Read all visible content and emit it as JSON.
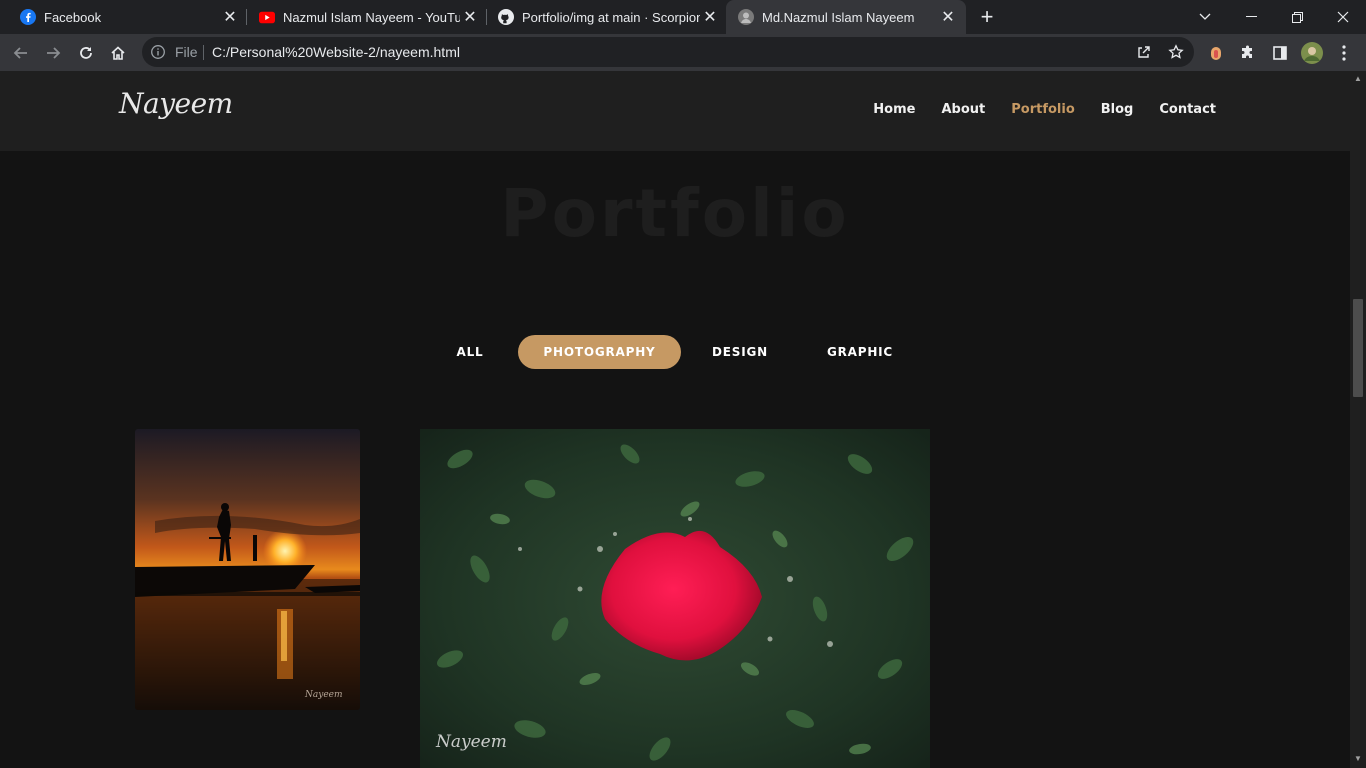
{
  "tabs": [
    {
      "title": "Facebook",
      "icon": "facebook-icon"
    },
    {
      "title": "Nazmul Islam Nayeem - YouTube",
      "icon": "youtube-icon"
    },
    {
      "title": "Portfolio/img at main · ScorpionN",
      "icon": "github-icon"
    },
    {
      "title": "Md.Nazmul Islam Nayeem",
      "icon": "site-icon",
      "active": true
    }
  ],
  "address": {
    "scheme_label": "File",
    "url": "C:/Personal%20Website-2/nayeem.html"
  },
  "site": {
    "logo": "Nayeem",
    "nav": [
      "Home",
      "About",
      "Portfolio",
      "Blog",
      "Contact"
    ],
    "active_nav": "Portfolio",
    "section_title": "Portfolio",
    "filters": [
      "ALL",
      "PHOTOGRAPHY",
      "DESIGN",
      "GRAPHIC"
    ],
    "active_filter": "PHOTOGRAPHY",
    "watermark": "Nayeem"
  },
  "colors": {
    "accent": "#c69963",
    "nav_bg": "#1f1f1f",
    "page_bg": "#131313"
  }
}
